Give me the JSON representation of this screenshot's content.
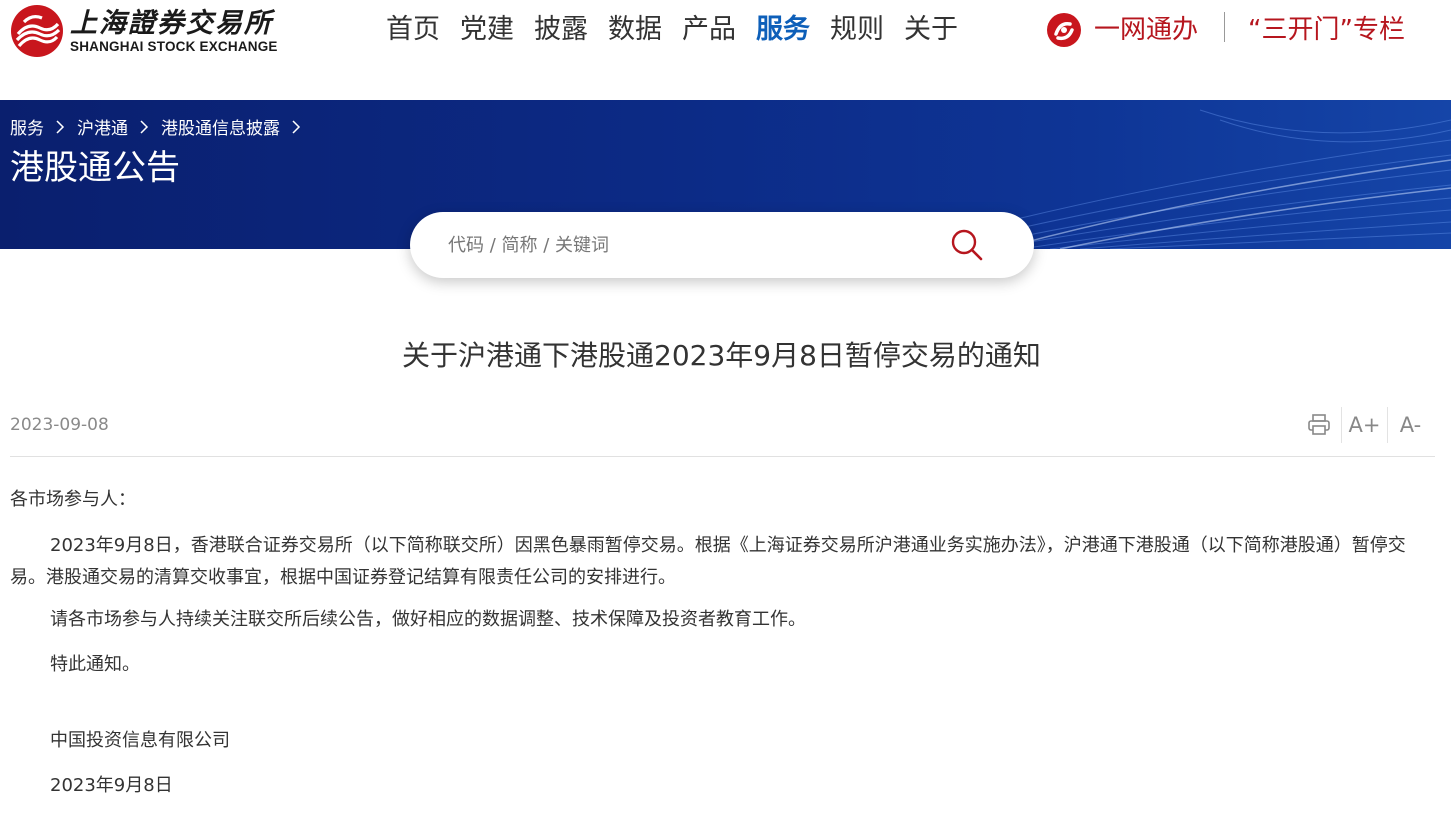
{
  "header": {
    "logo": {
      "name_cn": "上海證券交易所",
      "name_en": "SHANGHAI STOCK EXCHANGE",
      "icon": "sse-logo-icon"
    },
    "nav": [
      {
        "label": "首页",
        "active": false
      },
      {
        "label": "党建",
        "active": false
      },
      {
        "label": "披露",
        "active": false
      },
      {
        "label": "数据",
        "active": false
      },
      {
        "label": "产品",
        "active": false
      },
      {
        "label": "服务",
        "active": true
      },
      {
        "label": "规则",
        "active": false
      },
      {
        "label": "关于",
        "active": false
      }
    ],
    "onenet_label": "一网通办",
    "onenet_icon": "onenet-logo-icon",
    "sankai_label": "“三开门”专栏"
  },
  "banner": {
    "breadcrumb": [
      "服务",
      "沪港通",
      "港股通信息披露"
    ],
    "title": "港股通公告"
  },
  "search": {
    "placeholder": "代码 / 简称 / 关键词",
    "value": "",
    "icon": "search-icon"
  },
  "article": {
    "title": "关于沪港通下港股通2023年9月8日暂停交易的通知",
    "date": "2023-09-08",
    "tools": {
      "print_icon": "printer-icon",
      "font_increase": "A+",
      "font_decrease": "A-"
    },
    "salutation": "各市场参与人：",
    "paragraphs": [
      "2023年9月8日，香港联合证券交易所（以下简称联交所）因黑色暴雨暂停交易。根据《上海证券交易所沪港通业务实施办法》，沪港通下港股通（以下简称港股通）暂停交易。港股通交易的清算交收事宜，根据中国证券登记结算有限责任公司的安排进行。",
      "请各市场参与人持续关注联交所后续公告，做好相应的数据调整、技术保障及投资者教育工作。",
      "特此通知。"
    ],
    "signature_org": "中国投资信息有限公司",
    "signature_date": "2023年9月8日"
  },
  "colors": {
    "brand_red": "#b6161e",
    "nav_active": "#0d5fb9",
    "banner_blue": "#0c2a85"
  }
}
